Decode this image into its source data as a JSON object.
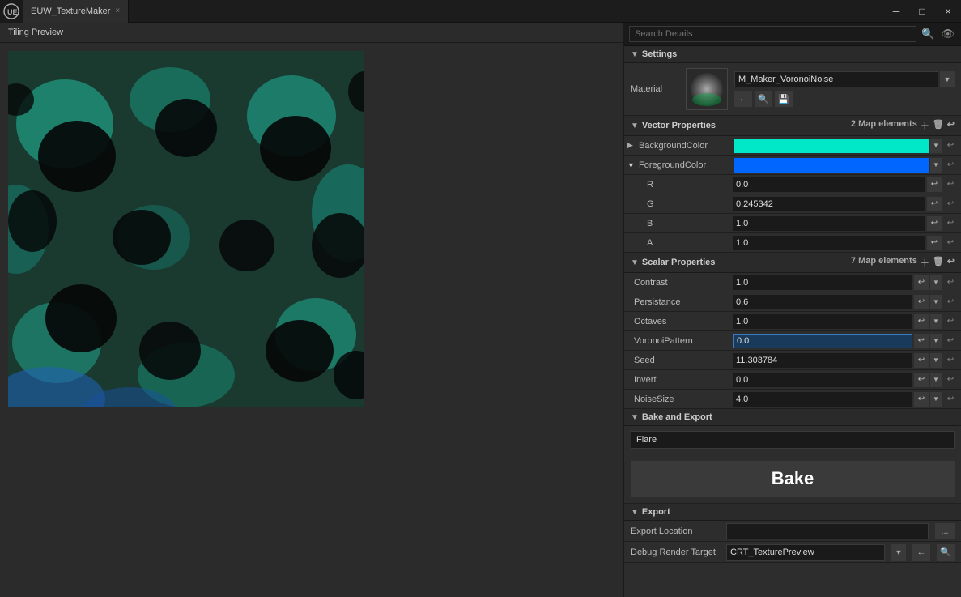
{
  "titlebar": {
    "tab_label": "EUW_TextureMaker",
    "close_label": "×",
    "minimize_label": "─",
    "maximize_label": "□"
  },
  "left_panel": {
    "title": "Tiling Preview"
  },
  "right_panel": {
    "search_placeholder": "Search Details",
    "settings_header": "Settings",
    "material_label": "Material",
    "material_name": "M_Maker_VoronoiNoise",
    "vector_properties_header": "Vector Properties",
    "map_elements_count": "2 Map elements",
    "bg_color_label": "BackgroundColor",
    "fg_color_label": "ForegroundColor",
    "r_label": "R",
    "g_label": "G",
    "b_label": "B",
    "a_label": "A",
    "r_value": "0.0",
    "g_value": "0.245342",
    "b_value": "1.0",
    "a_value": "1.0",
    "scalar_properties_header": "Scalar Properties",
    "scalar_map_elements_count": "7 Map elements",
    "contrast_label": "Contrast",
    "contrast_value": "1.0",
    "persistance_label": "Persistance",
    "persistance_value": "0.6",
    "octaves_label": "Octaves",
    "octaves_value": "1.0",
    "voronoi_label": "VoronoiPattern",
    "voronoi_value": "0.0",
    "seed_label": "Seed",
    "seed_value": "11.303784",
    "invert_label": "Invert",
    "invert_value": "0.0",
    "noisesize_label": "NoiseSize",
    "noisesize_value": "4.0",
    "bake_export_header": "Bake and Export",
    "bake_name": "Flare",
    "bake_button_label": "Bake",
    "export_header": "Export",
    "export_location_label": "Export Location",
    "export_location_value": "",
    "export_browse_label": "...",
    "debug_render_label": "Debug Render Target",
    "debug_render_value": "CRT_TexturePreview",
    "bg_color_hex": "#00e8c8",
    "fg_color_hex": "#0066ff"
  }
}
